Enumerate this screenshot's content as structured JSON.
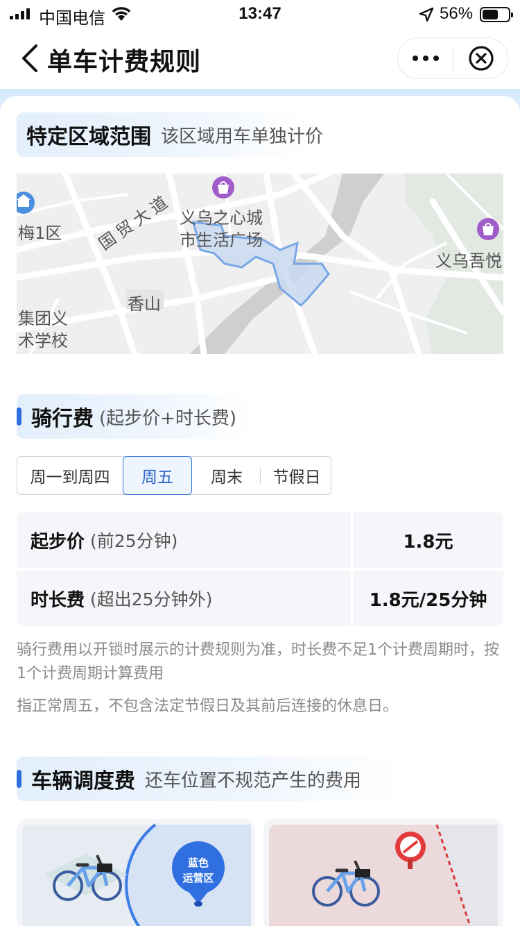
{
  "status_bar": {
    "carrier": "中国电信",
    "time": "13:47",
    "battery": "56%"
  },
  "nav": {
    "title": "单车计费规则"
  },
  "zone_section": {
    "title": "特定区域范围",
    "subtitle": "该区域用车单独计价",
    "map_labels": {
      "mall": "义乌之心城",
      "plaza": "市生活广场",
      "road": "国贸大道",
      "district": "梅1区",
      "hill": "香山",
      "school_1": "集团义",
      "school_2": "术学校",
      "wuyue": "义乌吾悦"
    }
  },
  "ride_section": {
    "title": "骑行费",
    "subtitle": "(起步价+时长费)",
    "tabs": [
      {
        "label": "周一到周四",
        "active": false
      },
      {
        "label": "周五",
        "active": true
      },
      {
        "label": "周末",
        "active": false
      },
      {
        "label": "节假日",
        "active": false
      }
    ],
    "rows": [
      {
        "name": "起步价",
        "note": "(前25分钟)",
        "price": "1.8元"
      },
      {
        "name": "时长费",
        "note": "(超出25分钟外)",
        "price": "1.8元/25分钟"
      }
    ],
    "note_1": "骑行费用以开锁时展示的计费规则为准，时长费不足1个计费周期时，按1个计费周期计算费用",
    "note_2": "指正常周五，不包含法定节假日及其前后连接的休息日。"
  },
  "dispatch_section": {
    "title": "车辆调度费",
    "subtitle": "还车位置不规范产生的费用",
    "pin_line_1": "蓝色",
    "pin_line_2": "运营区"
  },
  "colors": {
    "accent": "#2e6fe0",
    "zone_fill": "#cfdff2",
    "zone_stroke": "#7aa7e6"
  }
}
